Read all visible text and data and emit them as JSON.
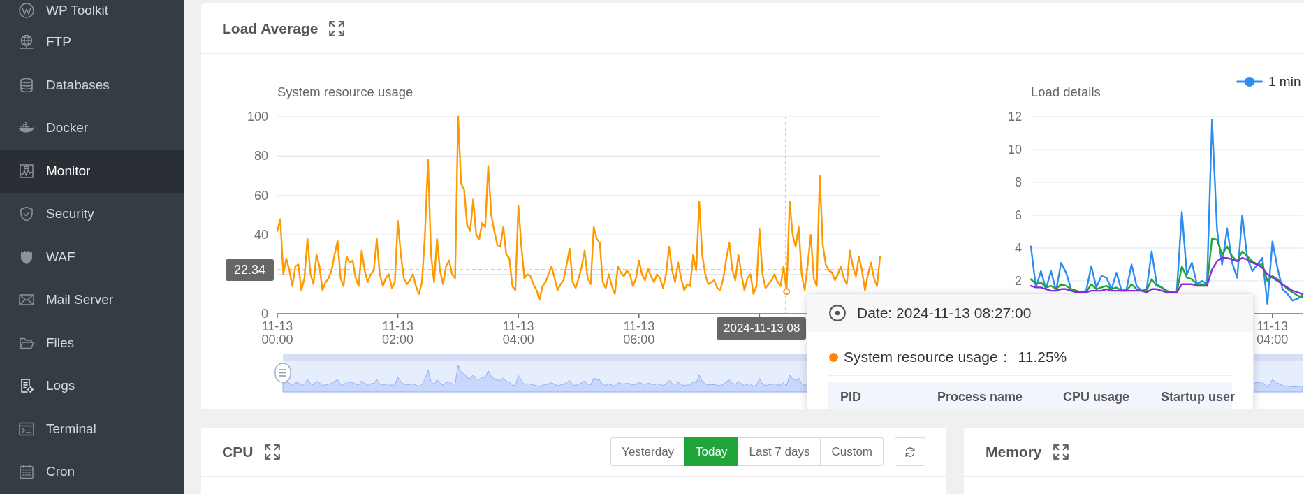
{
  "sidebar": {
    "items": [
      {
        "label": "WP Toolkit",
        "selected": false
      },
      {
        "label": "FTP",
        "selected": false
      },
      {
        "label": "Databases",
        "selected": false
      },
      {
        "label": "Docker",
        "selected": false
      },
      {
        "label": "Monitor",
        "selected": true
      },
      {
        "label": "Security",
        "selected": false
      },
      {
        "label": "WAF",
        "selected": false
      },
      {
        "label": "Mail Server",
        "selected": false
      },
      {
        "label": "Files",
        "selected": false
      },
      {
        "label": "Logs",
        "selected": false
      },
      {
        "label": "Terminal",
        "selected": false
      },
      {
        "label": "Cron",
        "selected": false
      }
    ]
  },
  "load_average": {
    "title": "Load Average",
    "system_usage_chart": {
      "chart_data": {
        "type": "line",
        "title": "System resource usage",
        "categories": [
          "11-13 00:00",
          null,
          null,
          null,
          null,
          null,
          null,
          null,
          null,
          null,
          null,
          null,
          null,
          null,
          null,
          null,
          null,
          null,
          null,
          null,
          null,
          null,
          null,
          null,
          null,
          null,
          null,
          null,
          null,
          null,
          null,
          null,
          null,
          null,
          null,
          null,
          null,
          null,
          null,
          null,
          "11-13 02:00",
          null,
          null,
          null,
          null,
          null,
          null,
          null,
          null,
          null,
          null,
          null,
          null,
          null,
          null,
          null,
          null,
          null,
          null,
          null,
          null,
          null,
          null,
          null,
          null,
          null,
          null,
          null,
          null,
          null,
          null,
          null,
          null,
          null,
          null,
          null,
          null,
          null,
          null,
          null,
          "11-13 04:00",
          null,
          null,
          null,
          null,
          null,
          null,
          null,
          null,
          null,
          null,
          null,
          null,
          null,
          null,
          null,
          null,
          null,
          null,
          null,
          null,
          null,
          null,
          null,
          null,
          null,
          null,
          null,
          null,
          null,
          null,
          null,
          null,
          null,
          null,
          null,
          null,
          null,
          null,
          null,
          "11-13 06:00",
          null,
          null,
          null,
          null,
          null,
          null,
          null,
          null,
          null,
          null,
          null,
          null,
          null,
          null,
          null,
          null,
          null,
          null,
          null,
          null,
          null,
          null,
          null,
          null,
          null,
          null,
          null,
          null,
          null,
          null,
          null,
          null,
          null,
          null,
          null,
          null,
          null,
          null,
          null,
          null,
          null,
          null,
          null,
          null,
          null,
          null,
          null,
          null,
          null,
          null,
          null,
          null,
          null,
          null,
          null,
          null,
          null,
          null,
          null,
          null,
          null,
          null,
          null,
          null,
          null,
          null,
          null,
          null,
          null,
          null,
          null,
          null,
          null,
          null,
          null,
          null,
          null,
          null,
          null,
          null
        ],
        "series": [
          {
            "color": "#ff9900",
            "values": [
              42,
              48,
              20,
              28,
              22,
              14,
              24,
              25,
              12,
              18,
              38,
              20,
              15,
              30,
              24,
              12,
              16,
              18,
              22,
              30,
              37,
              18,
              14,
              29,
              26,
              27,
              18,
              14,
              32,
              22,
              16,
              20,
              22,
              38,
              20,
              14,
              18,
              20,
              13,
              16,
              47,
              30,
              18,
              15,
              17,
              20,
              14,
              10,
              16,
              40,
              78,
              30,
              16,
              38,
              22,
              15,
              24,
              27,
              20,
              18,
              100,
              66,
              63,
              45,
              42,
              58,
              40,
              38,
              46,
              44,
              75,
              50,
              42,
              35,
              34,
              44,
              30,
              28,
              14,
              12,
              55,
              34,
              18,
              20,
              19,
              15,
              12,
              7,
              14,
              16,
              20,
              24,
              18,
              12,
              15,
              17,
              25,
              33,
              16,
              13,
              18,
              24,
              32,
              18,
              15,
              44,
              38,
              36,
              16,
              13,
              20,
              14,
              10,
              24,
              21,
              19,
              22,
              20,
              14,
              18,
              27,
              20,
              17,
              23,
              19,
              16,
              20,
              18,
              13,
              20,
              34,
              22,
              16,
              26,
              18,
              12,
              15,
              14,
              30,
              22,
              57,
              30,
              20,
              15,
              16,
              17,
              13,
              12,
              18,
              28,
              36,
              22,
              17,
              30,
              20,
              12,
              18,
              20,
              10,
              14,
              43,
              20,
              13,
              15,
              17,
              20,
              16,
              14,
              24,
              11.25,
              57,
              40,
              34,
              44,
              20,
              12,
              25,
              40,
              18,
              14,
              70,
              35,
              25,
              22,
              21,
              17,
              20,
              24,
              18,
              15,
              32,
              24,
              19,
              29,
              22,
              12,
              20,
              26,
              18,
              14,
              29
            ]
          }
        ],
        "ylim": [
          0,
          100
        ],
        "yticks": [
          0,
          40,
          60,
          80,
          100
        ],
        "grid": true,
        "ref_lines": [
          {
            "axis": "y",
            "value": 22.34,
            "label": "22.34"
          }
        ]
      }
    },
    "load_details_chart": {
      "chart_data": {
        "type": "line",
        "title": "Load details",
        "categories": [
          null,
          null,
          null,
          null,
          null,
          null,
          null,
          null,
          null,
          null,
          null,
          null,
          null,
          null,
          null,
          null,
          null,
          null,
          null,
          null,
          null,
          null,
          null,
          null,
          null,
          null,
          null,
          null,
          null,
          null,
          null,
          null,
          null,
          null,
          null,
          null,
          null,
          null,
          null,
          null,
          null,
          null,
          null,
          null,
          null,
          null,
          null,
          null,
          "11-13 04:00",
          null,
          null,
          null,
          null,
          null,
          null
        ],
        "series": [
          {
            "name": "1 min",
            "color": "#2d8cf0",
            "values": [
              4.1,
              1.6,
              2.6,
              1.5,
              2.6,
              1.4,
              3.1,
              2.5,
              1.5,
              1.4,
              1.3,
              1.4,
              2.9,
              1.6,
              2.3,
              2.2,
              1.5,
              2.5,
              1.4,
              1.5,
              3.0,
              1.7,
              1.4,
              1.5,
              3.8,
              1.8,
              1.6,
              1.3,
              null,
              1.4,
              6.2,
              2.4,
              3.1,
              1.8,
              2.0,
              1.8,
              11.8,
              5.1,
              3.0,
              5.2,
              3.1,
              2.2,
              6.0,
              3.4,
              2.6,
              3.0,
              3.4,
              0.6,
              4.4,
              2.8,
              1.5,
              1.2,
              0.8,
              0.9,
              1.2
            ]
          },
          {
            "color": "#20a53a",
            "values": [
              2.1,
              1.8,
              1.9,
              1.6,
              1.7,
              1.5,
              1.8,
              1.7,
              1.5,
              1.4,
              1.3,
              1.3,
              1.8,
              1.5,
              1.6,
              1.7,
              1.5,
              1.6,
              1.4,
              1.4,
              1.8,
              1.5,
              1.4,
              1.4,
              2.1,
              1.7,
              1.6,
              1.4,
              1.3,
              1.3,
              2.9,
              2.2,
              2.1,
              1.8,
              1.8,
              1.7,
              4.6,
              4.5,
              3.6,
              4.1,
              3.5,
              3.2,
              3.8,
              3.5,
              3.2,
              3.0,
              3.0,
              2.0,
              2.3,
              2.1,
              1.8,
              1.5,
              1.3,
              1.1,
              1.0
            ]
          },
          {
            "color": "#8a2be2",
            "values": [
              1.7,
              1.6,
              1.6,
              1.5,
              1.4,
              1.4,
              1.5,
              1.5,
              1.4,
              1.3,
              1.3,
              1.3,
              1.4,
              1.4,
              1.4,
              1.5,
              1.4,
              1.4,
              1.4,
              1.4,
              1.4,
              1.4,
              1.4,
              1.3,
              1.5,
              1.5,
              1.4,
              1.3,
              1.3,
              1.3,
              1.8,
              1.8,
              1.8,
              1.7,
              1.7,
              1.7,
              2.7,
              3.2,
              3.4,
              3.4,
              3.3,
              3.2,
              3.4,
              3.3,
              3.1,
              3.0,
              2.8,
              2.4,
              2.2,
              2.0,
              1.8,
              1.6,
              1.4,
              1.3,
              1.2
            ]
          }
        ],
        "ylim": [
          0,
          12
        ],
        "yticks": [
          2,
          4,
          6,
          8,
          10,
          12
        ],
        "grid": true
      }
    },
    "axis_pointer": {
      "label": "2024-11-13 08"
    },
    "tooltip": {
      "date": "Date: 2024-11-13 08:27:00",
      "series": [
        {
          "name": "System resource usage：",
          "value": "11.25%",
          "color": "#ff8800"
        }
      ],
      "columns": [
        "PID",
        "Process name",
        "CPU usage",
        "Startup user"
      ]
    }
  },
  "cpu": {
    "title": "CPU",
    "ranges": [
      {
        "label": "Yesterday",
        "selected": false
      },
      {
        "label": "Today",
        "selected": true
      },
      {
        "label": "Last 7 days",
        "selected": false
      },
      {
        "label": "Custom",
        "selected": false
      }
    ]
  },
  "memory": {
    "title": "Memory"
  }
}
